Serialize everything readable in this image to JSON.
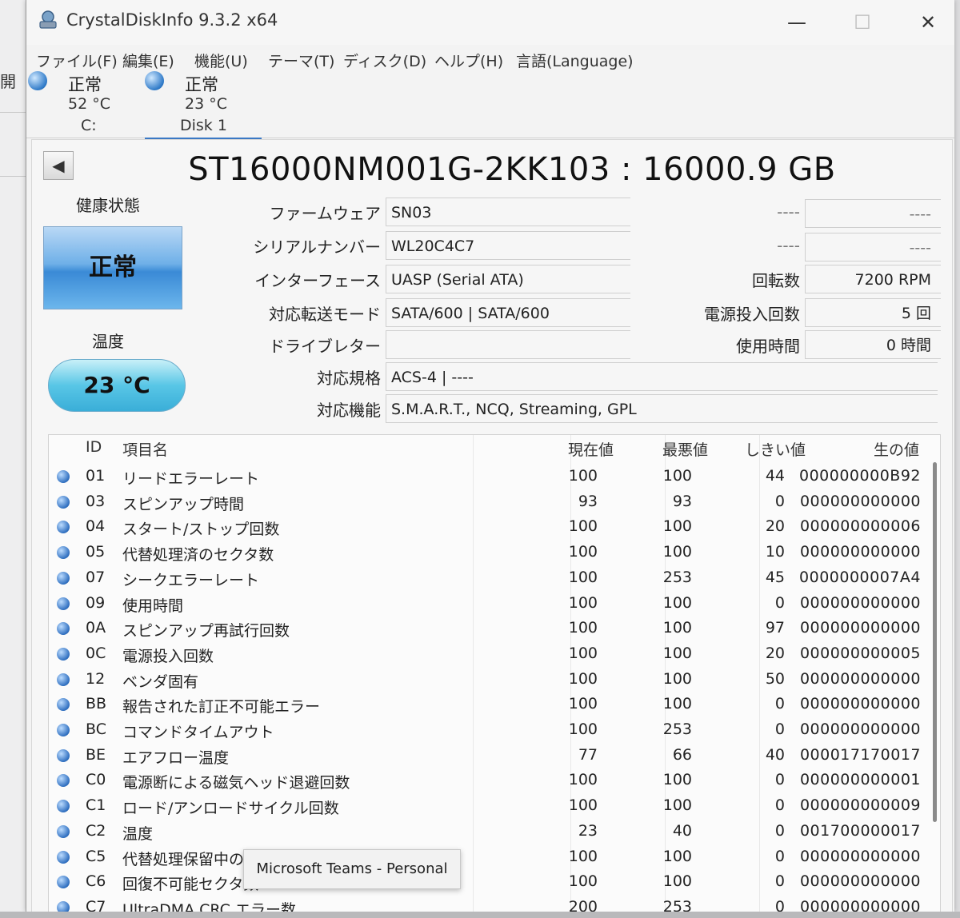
{
  "window": {
    "title": "CrystalDiskInfo 9.3.2 x64",
    "minimize": "—",
    "maximize": "☐",
    "close": "✕"
  },
  "background_window": {
    "fragment": "開"
  },
  "menu": [
    "ファイル(F)",
    "編集(E)",
    "機能(U)",
    "テーマ(T)",
    "ディスク(D)",
    "ヘルプ(H)",
    "言語(Language)"
  ],
  "disks": [
    {
      "status": "正常",
      "temp": "52 °C",
      "name": "C:"
    },
    {
      "status": "正常",
      "temp": "23 °C",
      "name": "Disk 1"
    }
  ],
  "drive": {
    "prev_button": "◀",
    "model": "ST16000NM001G-2KK103 : 16000.9 GB",
    "health_label": "健康状態",
    "health_value": "正常",
    "temp_label": "温度",
    "temp_value": "23 °C",
    "info": [
      {
        "label": "ファームウェア",
        "value": "SN03"
      },
      {
        "label": "シリアルナンバー",
        "value": "WL20C4C7"
      },
      {
        "label": "インターフェース",
        "value": "UASP (Serial ATA)"
      },
      {
        "label": "対応転送モード",
        "value": "SATA/600 | SATA/600"
      },
      {
        "label": "ドライブレター",
        "value": ""
      },
      {
        "label": "対応規格",
        "value": "ACS-4 | ----"
      },
      {
        "label": "対応機能",
        "value": "S.M.A.R.T., NCQ, Streaming, GPL"
      }
    ],
    "right_info": [
      {
        "label": "----",
        "value": "----"
      },
      {
        "label": "----",
        "value": "----"
      },
      {
        "label": "回転数",
        "value": "7200 RPM"
      },
      {
        "label": "電源投入回数",
        "value": "5 回"
      },
      {
        "label": "使用時間",
        "value": "0 時間"
      }
    ]
  },
  "smart": {
    "headers": {
      "id": "ID",
      "name": "項目名",
      "current": "現在値",
      "worst": "最悪値",
      "threshold": "しきい値",
      "raw": "生の値"
    },
    "rows": [
      {
        "id": "01",
        "name": "リードエラーレート",
        "current": "100",
        "worst": "100",
        "threshold": "44",
        "raw": "000000000B92"
      },
      {
        "id": "03",
        "name": "スピンアップ時間",
        "current": "93",
        "worst": "93",
        "threshold": "0",
        "raw": "000000000000"
      },
      {
        "id": "04",
        "name": "スタート/ストップ回数",
        "current": "100",
        "worst": "100",
        "threshold": "20",
        "raw": "000000000006"
      },
      {
        "id": "05",
        "name": "代替処理済のセクタ数",
        "current": "100",
        "worst": "100",
        "threshold": "10",
        "raw": "000000000000"
      },
      {
        "id": "07",
        "name": "シークエラーレート",
        "current": "100",
        "worst": "253",
        "threshold": "45",
        "raw": "0000000007A4"
      },
      {
        "id": "09",
        "name": "使用時間",
        "current": "100",
        "worst": "100",
        "threshold": "0",
        "raw": "000000000000"
      },
      {
        "id": "0A",
        "name": "スピンアップ再試行回数",
        "current": "100",
        "worst": "100",
        "threshold": "97",
        "raw": "000000000000"
      },
      {
        "id": "0C",
        "name": "電源投入回数",
        "current": "100",
        "worst": "100",
        "threshold": "20",
        "raw": "000000000005"
      },
      {
        "id": "12",
        "name": "ベンダ固有",
        "current": "100",
        "worst": "100",
        "threshold": "50",
        "raw": "000000000000"
      },
      {
        "id": "BB",
        "name": "報告された訂正不可能エラー",
        "current": "100",
        "worst": "100",
        "threshold": "0",
        "raw": "000000000000"
      },
      {
        "id": "BC",
        "name": "コマンドタイムアウト",
        "current": "100",
        "worst": "253",
        "threshold": "0",
        "raw": "000000000000"
      },
      {
        "id": "BE",
        "name": "エアフロー温度",
        "current": "77",
        "worst": "66",
        "threshold": "40",
        "raw": "000017170017"
      },
      {
        "id": "C0",
        "name": "電源断による磁気ヘッド退避回数",
        "current": "100",
        "worst": "100",
        "threshold": "0",
        "raw": "000000000001"
      },
      {
        "id": "C1",
        "name": "ロード/アンロードサイクル回数",
        "current": "100",
        "worst": "100",
        "threshold": "0",
        "raw": "000000000009"
      },
      {
        "id": "C2",
        "name": "温度",
        "current": "23",
        "worst": "40",
        "threshold": "0",
        "raw": "001700000017"
      },
      {
        "id": "C5",
        "name": "代替処理保留中のセクタ数",
        "current": "100",
        "worst": "100",
        "threshold": "0",
        "raw": "000000000000"
      },
      {
        "id": "C6",
        "name": "回復不可能セクタ数",
        "current": "100",
        "worst": "100",
        "threshold": "0",
        "raw": "000000000000"
      },
      {
        "id": "C7",
        "name": "UltraDMA CRC エラー数",
        "current": "200",
        "worst": "253",
        "threshold": "0",
        "raw": "000000000000"
      }
    ]
  },
  "tooltip": "Microsoft Teams - Personal"
}
